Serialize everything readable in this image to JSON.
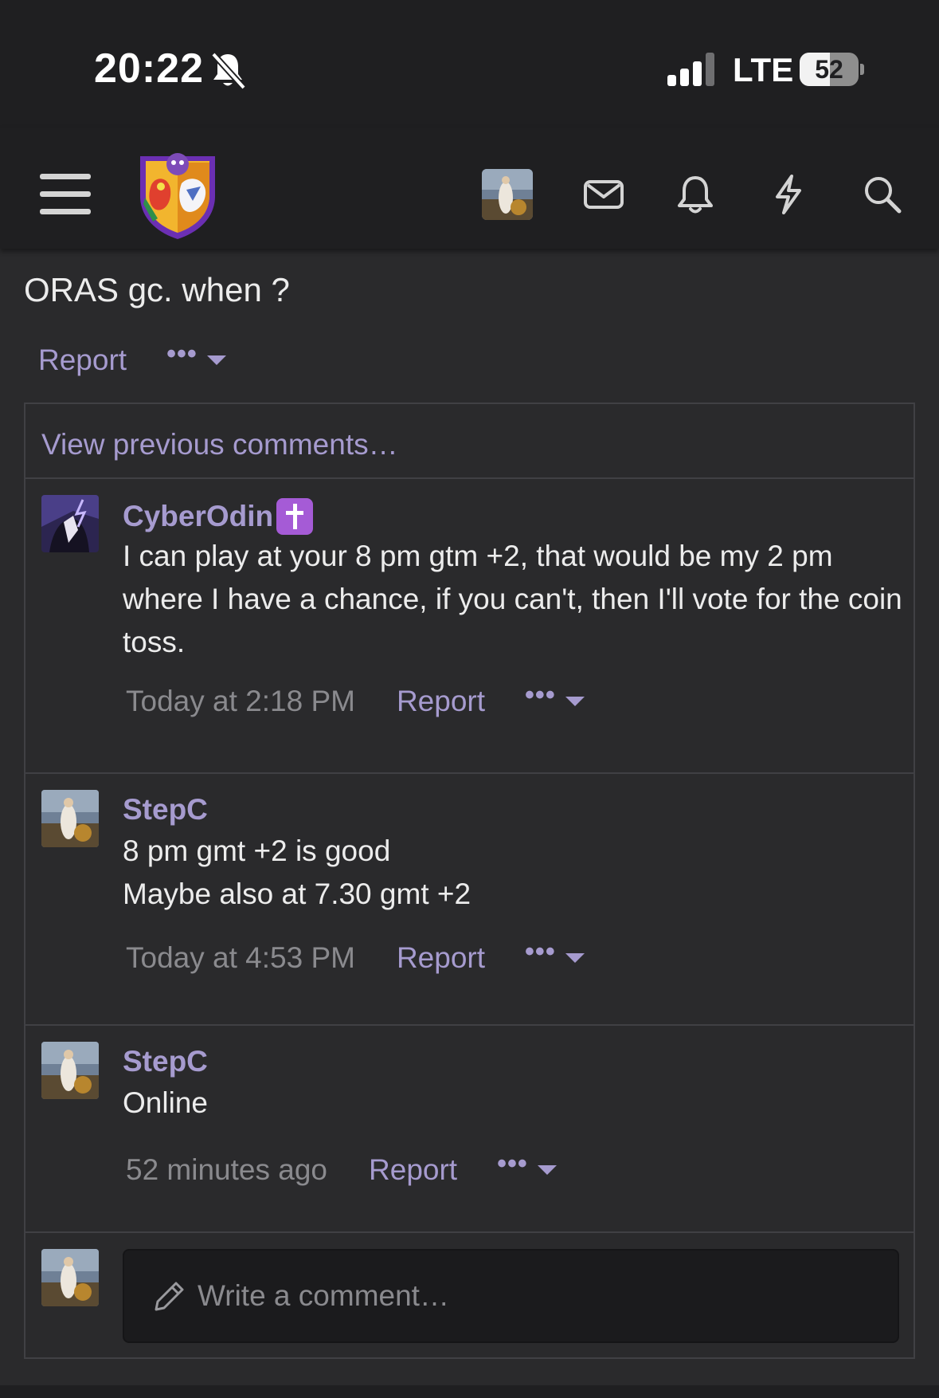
{
  "status_bar": {
    "time": "20:22",
    "network": "LTE",
    "battery": "52",
    "battery_level": 0.52,
    "icons": [
      "bell-off-icon",
      "signal-icon",
      "battery-icon"
    ]
  },
  "navbar": {
    "icons": [
      "menu-icon",
      "forum-logo",
      "user-avatar",
      "mail-icon",
      "bell-icon",
      "bolt-icon",
      "search-icon"
    ]
  },
  "post": {
    "text": "ORAS gc. when ?",
    "report_label": "Report",
    "more_label": "•••"
  },
  "comments": {
    "view_previous": "View previous comments…",
    "items": [
      {
        "author": "CyberOdin",
        "body": "I can play at your 8 pm gtm +2, that would be my 2 pm where I have a chance, if you can't, then I'll vote for the coin toss.",
        "time": "Today at 2:18 PM",
        "report": "Report",
        "more": "•••"
      },
      {
        "author": "StepC",
        "body_line1": "8 pm gmt +2 is good",
        "body_line2": "Maybe also at 7.30 gmt +2",
        "time": "Today at 4:53 PM",
        "report": "Report",
        "more": "•••"
      },
      {
        "author": "StepC",
        "body": "Online",
        "time": "52 minutes ago",
        "report": "Report",
        "more": "•••"
      }
    ],
    "write_placeholder": "Write a comment…"
  },
  "colors": {
    "background": "#2a2a2c",
    "bar": "#1f1f21",
    "accent": "#a69bcf",
    "muted": "#8a8a8e",
    "badge": "#a55bd6"
  }
}
